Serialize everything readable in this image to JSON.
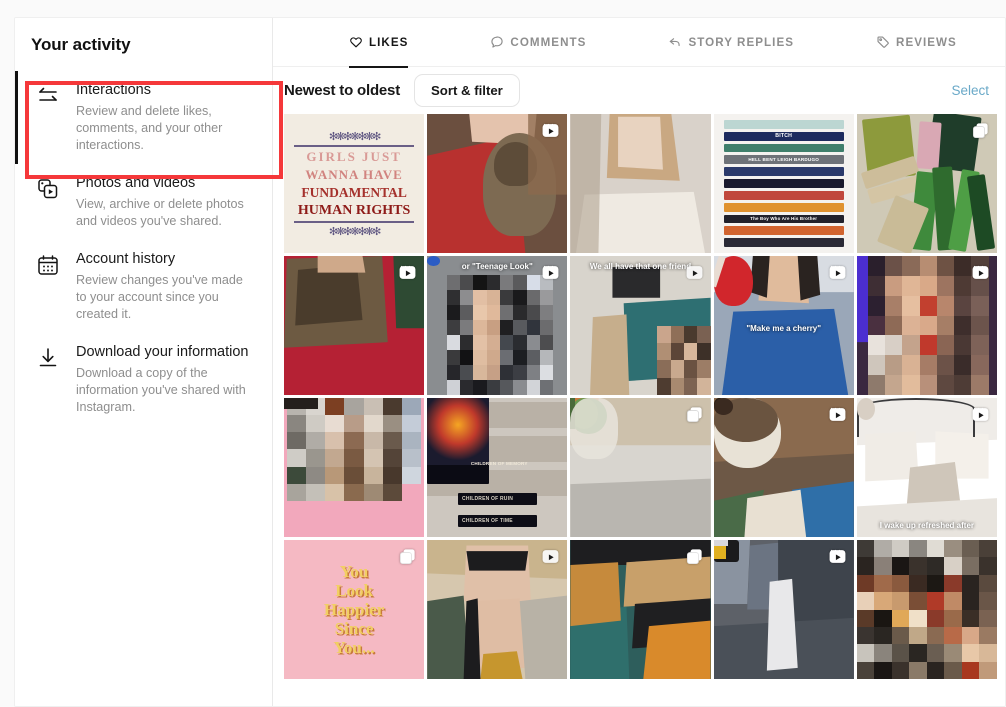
{
  "sidebar": {
    "title": "Your activity",
    "items": [
      {
        "label": "Interactions",
        "desc": "Review and delete likes, comments, and your other interactions.",
        "icon": "arrows-exchange-icon",
        "active": true,
        "highlighted": true
      },
      {
        "label": "Photos and videos",
        "desc": "View, archive or delete photos and videos you've shared.",
        "icon": "photos-videos-icon",
        "active": false,
        "highlighted": false
      },
      {
        "label": "Account history",
        "desc": "Review changes you've made to your account since you created it.",
        "icon": "calendar-icon",
        "active": false,
        "highlighted": false
      },
      {
        "label": "Download your information",
        "desc": "Download a copy of the information you've shared with Instagram.",
        "icon": "download-icon",
        "active": false,
        "highlighted": false
      }
    ]
  },
  "main": {
    "tabs": [
      {
        "label": "LIKES",
        "icon": "heart-icon",
        "active": true
      },
      {
        "label": "COMMENTS",
        "icon": "comment-icon",
        "active": false
      },
      {
        "label": "STORY REPLIES",
        "icon": "reply-arrow-icon",
        "active": false
      },
      {
        "label": "REVIEWS",
        "icon": "tag-icon",
        "active": false
      }
    ],
    "sortbar": {
      "sort_label": "Newest to oldest",
      "filter_button": "Sort & filter",
      "select_link": "Select"
    },
    "grid": [
      {
        "name": "girls-wanna-have-fundamental-human-rights",
        "kind": "stitch",
        "lines": [
          "GIRLS   JUST",
          "WANNA   HAVE",
          "FUNDAMENTAL",
          "HUMAN RIGHTS"
        ],
        "badge": "none",
        "caption": ""
      },
      {
        "name": "woman-with-cat-red-top",
        "kind": "redcat",
        "badge": "reel",
        "caption": ""
      },
      {
        "name": "woman-applying-lip-product",
        "kind": "portrait-light",
        "badge": "none",
        "caption": ""
      },
      {
        "name": "stack-of-books-bitch-hell-bent",
        "kind": "bookstack",
        "badge": "none",
        "caption": "",
        "titles": [
          "BITCH",
          "HELL BENT   LEIGH BARDUGO",
          "The Boy Who Are His Brother"
        ]
      },
      {
        "name": "green-books-flatlay",
        "kind": "greenbooks",
        "badge": "carousel",
        "caption": ""
      },
      {
        "name": "woman-holding-cat-red-dress",
        "kind": "redcat2",
        "badge": "reel",
        "caption": ""
      },
      {
        "name": "teenage-look-video",
        "kind": "censored-gray",
        "badge": "reel",
        "caption": "or \"Teenage Look\""
      },
      {
        "name": "we-all-have-that-one-friend",
        "kind": "room-teal",
        "badge": "reel",
        "caption": "We all have that one friend"
      },
      {
        "name": "make-me-a-cherry-crochet",
        "kind": "crochet",
        "badge": "reel",
        "caption": "\"Make me a cherry\""
      },
      {
        "name": "woman-purple-light-video",
        "kind": "censored-warm",
        "badge": "reel",
        "caption": ""
      },
      {
        "name": "person-pink-background",
        "kind": "censored-pink",
        "badge": "none",
        "caption": ""
      },
      {
        "name": "children-of-memory-book",
        "kind": "memory",
        "badge": "none",
        "caption": "",
        "titles": [
          "CHILDREN OF MEMORY",
          "CHILDREN OF RUIN",
          "CHILDREN OF TIME"
        ]
      },
      {
        "name": "miniature-potted-tree",
        "kind": "plant",
        "badge": "carousel",
        "caption": ""
      },
      {
        "name": "hedgehog-in-bath",
        "kind": "hedgehog",
        "badge": "reel",
        "caption": ""
      },
      {
        "name": "woman-in-bed-refreshed",
        "kind": "bedroom",
        "badge": "reel",
        "caption": "I wake up refreshed after"
      },
      {
        "name": "you-look-happier-since-you",
        "kind": "happier",
        "lines": [
          "You",
          "Look",
          "Happier",
          "Since",
          "You..."
        ],
        "badge": "carousel",
        "caption": ""
      },
      {
        "name": "woman-sunglasses-sunhat",
        "kind": "sunhat",
        "badge": "reel",
        "caption": ""
      },
      {
        "name": "person-in-car-leopard-print",
        "kind": "carint",
        "badge": "carousel",
        "caption": ""
      },
      {
        "name": "figure-crossing-city-street",
        "kind": "street",
        "badge": "reel",
        "caption": ""
      },
      {
        "name": "censored-dark-photo",
        "kind": "censored-dark",
        "badge": "none",
        "caption": ""
      }
    ]
  },
  "colors": {
    "accent_highlight": "#f5383a",
    "select_link": "#6aa9c8",
    "active_text": "#161616",
    "muted_text": "#8e8e8e"
  }
}
